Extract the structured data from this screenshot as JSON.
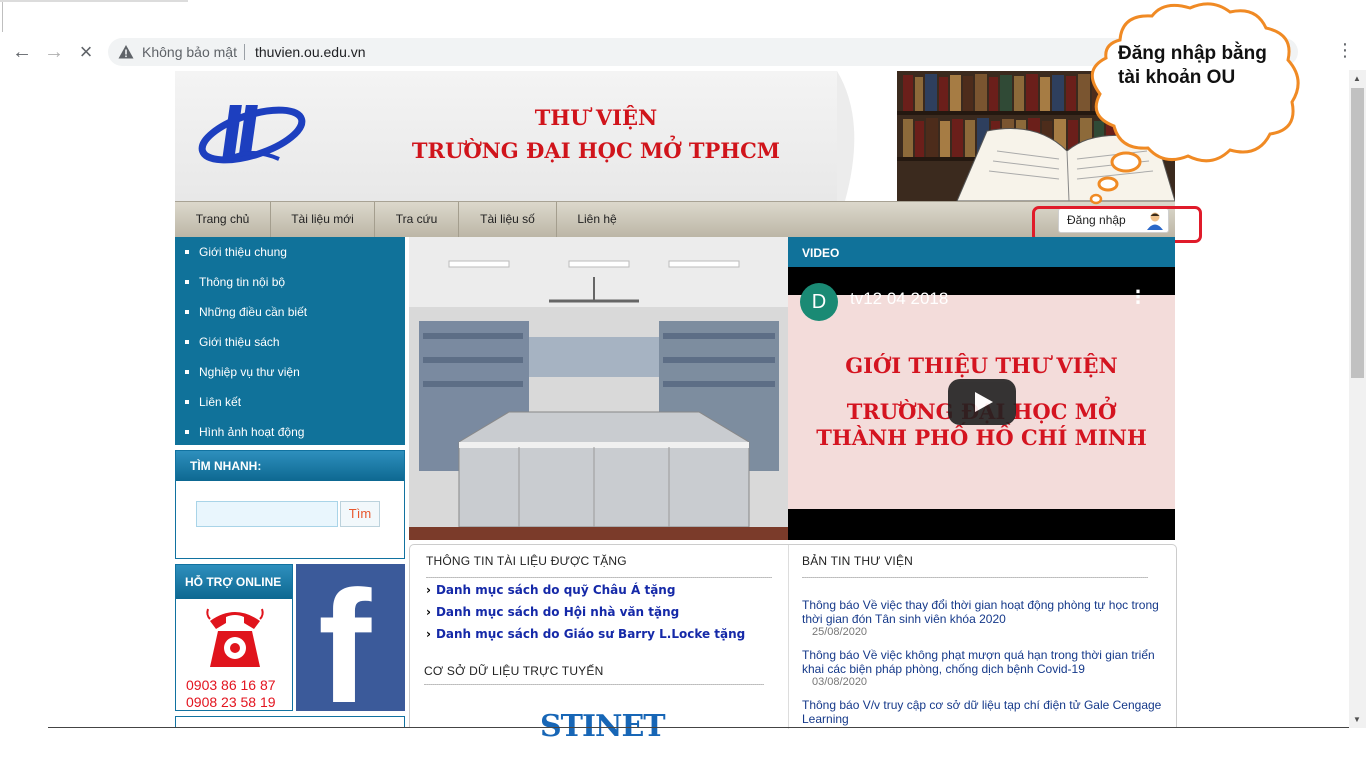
{
  "browser": {
    "security_label": "Không bảo mật",
    "url": "thuvien.ou.edu.vn"
  },
  "header": {
    "title_line1": "THƯ VIỆN",
    "title_line2": "TRƯỜNG ĐẠI HỌC MỞ TPHCM"
  },
  "topnav": {
    "items": [
      "Trang chủ",
      "Tài liệu mới",
      "Tra cứu",
      "Tài liệu số",
      "Liên hệ"
    ],
    "login_label": "Đăng nhập"
  },
  "sidebar": {
    "items": [
      "Giới thiệu chung",
      "Thông tin nội bộ",
      "Những điều cần biết",
      "Giới thiệu sách",
      "Nghiệp vụ thư viện",
      "Liên kết",
      "Hình ảnh hoạt động"
    ]
  },
  "search": {
    "title": "TÌM NHANH:",
    "button": "Tìm"
  },
  "support": {
    "title": "HỖ TRỢ ONLINE",
    "phone1": "0903 86 16 87",
    "phone2": "0908 23 58 19"
  },
  "video": {
    "header": "VIDEO",
    "channel_initial": "D",
    "title": "tv12 04 2018",
    "overlay_line1": "GIỚI THIỆU THƯ VIỆN",
    "overlay_line2": "TRƯỜNG ĐẠI HỌC MỞ",
    "overlay_line3": "THÀNH PHỐ HỒ CHÍ MINH"
  },
  "donations": {
    "title": "THÔNG TIN TÀI LIỆU ĐƯỢC TẶNG",
    "links": [
      "Danh mục sách do quỹ Châu Á tặng",
      "Danh mục sách do Hội nhà văn tặng",
      "Danh mục sách do Giáo sư Barry L.Locke tặng"
    ]
  },
  "databases": {
    "title": "CƠ SỞ DỮ LIỆU TRỰC TUYẾN",
    "first_logo": "STINET"
  },
  "news": {
    "title": "BẢN TIN THƯ VIỆN",
    "items": [
      {
        "text": "Thông báo Về việc thay đổi thời gian hoạt động phòng tự học trong thời gian đón Tân sinh viên khóa 2020",
        "date": "25/08/2020"
      },
      {
        "text": "Thông báo Về việc không phạt mượn quá hạn trong thời gian triển khai các biện pháp phòng, chống dịch bệnh Covid-19",
        "date": "03/08/2020"
      },
      {
        "text": "Thông báo V/v truy cập cơ sở dữ liệu tạp chí điện tử Gale Cengage Learning",
        "date": ""
      }
    ]
  },
  "annotation": {
    "callout": "Đăng nhập bằng tài khoản OU"
  },
  "colors": {
    "brand_blue": "#10729a",
    "title_red": "#d0141b",
    "highlight_red": "#e01b2a",
    "callout_orange": "#f08a24",
    "link_blue": "#1529a8"
  }
}
